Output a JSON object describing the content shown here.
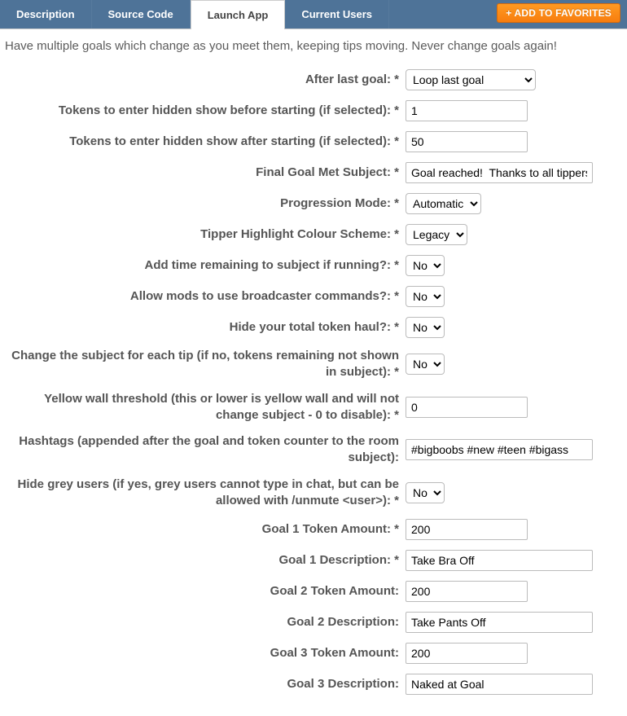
{
  "tabs": {
    "description": "Description",
    "source_code": "Source Code",
    "launch_app": "Launch App",
    "current_users": "Current Users"
  },
  "fav_button": "+ ADD TO FAVORITES",
  "intro": "Have multiple goals which change as you meet them, keeping tips moving. Never change goals again!",
  "fields": {
    "after_last_goal": {
      "label": "After last goal: *",
      "value": "Loop last goal"
    },
    "tokens_before": {
      "label": "Tokens to enter hidden show before starting (if selected): *",
      "value": "1"
    },
    "tokens_after": {
      "label": "Tokens to enter hidden show after starting (if selected): *",
      "value": "50"
    },
    "final_subject": {
      "label": "Final Goal Met Subject: *",
      "value": "Goal reached!  Thanks to all tippers!"
    },
    "progression_mode": {
      "label": "Progression Mode: *",
      "value": "Automatic"
    },
    "colour_scheme": {
      "label": "Tipper Highlight Colour Scheme: *",
      "value": "Legacy"
    },
    "add_time": {
      "label": "Add time remaining to subject if running?: *",
      "value": "No"
    },
    "allow_mods": {
      "label": "Allow mods to use broadcaster commands?: *",
      "value": "No"
    },
    "hide_haul": {
      "label": "Hide your total token haul?: *",
      "value": "No"
    },
    "change_subject": {
      "label": "Change the subject for each tip (if no, tokens remaining not shown in subject): *",
      "value": "No"
    },
    "yellow_wall": {
      "label": "Yellow wall threshold (this or lower is yellow wall and will not change subject - 0 to disable): *",
      "value": "0"
    },
    "hashtags": {
      "label": "Hashtags (appended after the goal and token counter to the room subject):",
      "value": "#bigboobs #new #teen #bigass"
    },
    "hide_grey": {
      "label": "Hide grey users (if yes, grey users cannot type in chat, but can be allowed with /unmute <user>): *",
      "value": "No"
    },
    "goal1_amt": {
      "label": "Goal 1 Token Amount: *",
      "value": "200"
    },
    "goal1_desc": {
      "label": "Goal 1 Description: *",
      "value": "Take Bra Off"
    },
    "goal2_amt": {
      "label": "Goal 2 Token Amount:",
      "value": "200"
    },
    "goal2_desc": {
      "label": "Goal 2 Description:",
      "value": "Take Pants Off"
    },
    "goal3_amt": {
      "label": "Goal 3 Token Amount:",
      "value": "200"
    },
    "goal3_desc": {
      "label": "Goal 3 Description:",
      "value": "Naked at Goal"
    }
  }
}
